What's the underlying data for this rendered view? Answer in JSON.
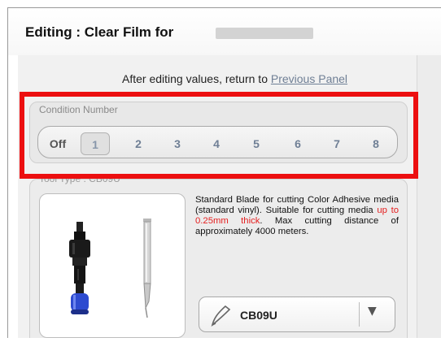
{
  "window": {
    "title": "Editing : Clear Film for"
  },
  "instruction": {
    "text": "After editing values, return to ",
    "link_label": "Previous Panel"
  },
  "condition": {
    "label": "Condition Number",
    "options": [
      "Off",
      "1",
      "2",
      "3",
      "4",
      "5",
      "6",
      "7",
      "8"
    ],
    "selected": "1"
  },
  "tool": {
    "label": "Tool Type : CB09U",
    "description_part1": "Standard Blade for cutting Color Adhesive media (standard vinyl). Suitable for cutting media ",
    "description_red": "up to 0.25mm thick",
    "description_part2": ". Max cutting distance of approximately 4000 meters.",
    "selected_tool": "CB09U"
  },
  "colors": {
    "highlight": "#ec0f10",
    "link": "#6f7f95",
    "warning_text": "#e41e1e",
    "holder_blue": "#2d4bd0"
  },
  "icons": {
    "pen": "pen-icon",
    "dropdown": "chevron-down-icon"
  }
}
